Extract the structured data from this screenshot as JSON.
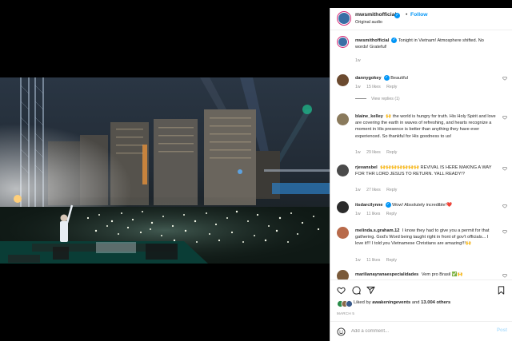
{
  "post": {
    "username": "mwsmithofficial",
    "follow_separator": "•",
    "follow_label": "Follow",
    "audio": "Original audio"
  },
  "comments": [
    {
      "username": "mwsmithofficial",
      "text": "Tonight in Vietnam! Atmosphere shifted. No words! Grateful!",
      "time": "1w",
      "likes": "",
      "reply": "",
      "avatar_color": "#3a6ea5"
    },
    {
      "username": "dannygokey",
      "text": "Beautiful",
      "time": "1w",
      "likes": "15 likes",
      "reply": "Reply",
      "avatar_color": "#6b4a2f",
      "view_replies": "View replies (1)"
    },
    {
      "username": "blaine_kelley",
      "text": "🙌 the world is hungry for truth. His Holy Spirit and love are covering the earth in waves of refreshing, and hearts recognize a moment in His presence is better than anything they have ever experienced. So thankful for His goodness to us!",
      "time": "1w",
      "likes": "29 likes",
      "reply": "Reply",
      "avatar_color": "#8a7a5c"
    },
    {
      "username": "rjevansbel",
      "text": "🙌🙌🙌🙌🙌🙌🙌 REVIVAL IS HERE MAKING A WAY FOR THR LORD JESUS TO RETURN. YALL READY!?",
      "time": "1w",
      "likes": "27 likes",
      "reply": "Reply",
      "avatar_color": "#4a4a4a"
    },
    {
      "username": "itsdarcilynne",
      "text": "Wow! Absolutely incredible!❤️",
      "time": "1w",
      "likes": "11 likes",
      "reply": "Reply",
      "avatar_color": "#2b2b2b"
    },
    {
      "username": "melinda.s.graham.12",
      "text": "I know they had to give you a permit for that gathering. God's Word being taught right in front of gov't officials... I love it!!! I told you Vietnamese Christians are amazing!!!🙌",
      "time": "1w",
      "likes": "11 likes",
      "reply": "Reply",
      "avatar_color": "#b86a4a"
    },
    {
      "username": "marilianayranaespecialidades",
      "text": "Vem pro Brasil ✅🙌",
      "time": "",
      "likes": "",
      "reply": "",
      "avatar_color": "#7a5a3a"
    }
  ],
  "actions": {
    "liked_by_prefix": "Liked by",
    "liked_by_user": "awakeningevents",
    "liked_and": "and",
    "others_count": "13.004 others",
    "date": "MARCH 5"
  },
  "compose": {
    "placeholder": "Add a comment...",
    "post_label": "Post"
  },
  "icons": {
    "like": "heart-icon",
    "comment": "comment-icon",
    "share": "share-icon",
    "save": "bookmark-icon",
    "emoji": "emoji-icon"
  },
  "colors": {
    "accent": "#0095f6",
    "post_disabled": "#b2dffc",
    "muted": "#8e8e8e",
    "text": "#262626"
  }
}
